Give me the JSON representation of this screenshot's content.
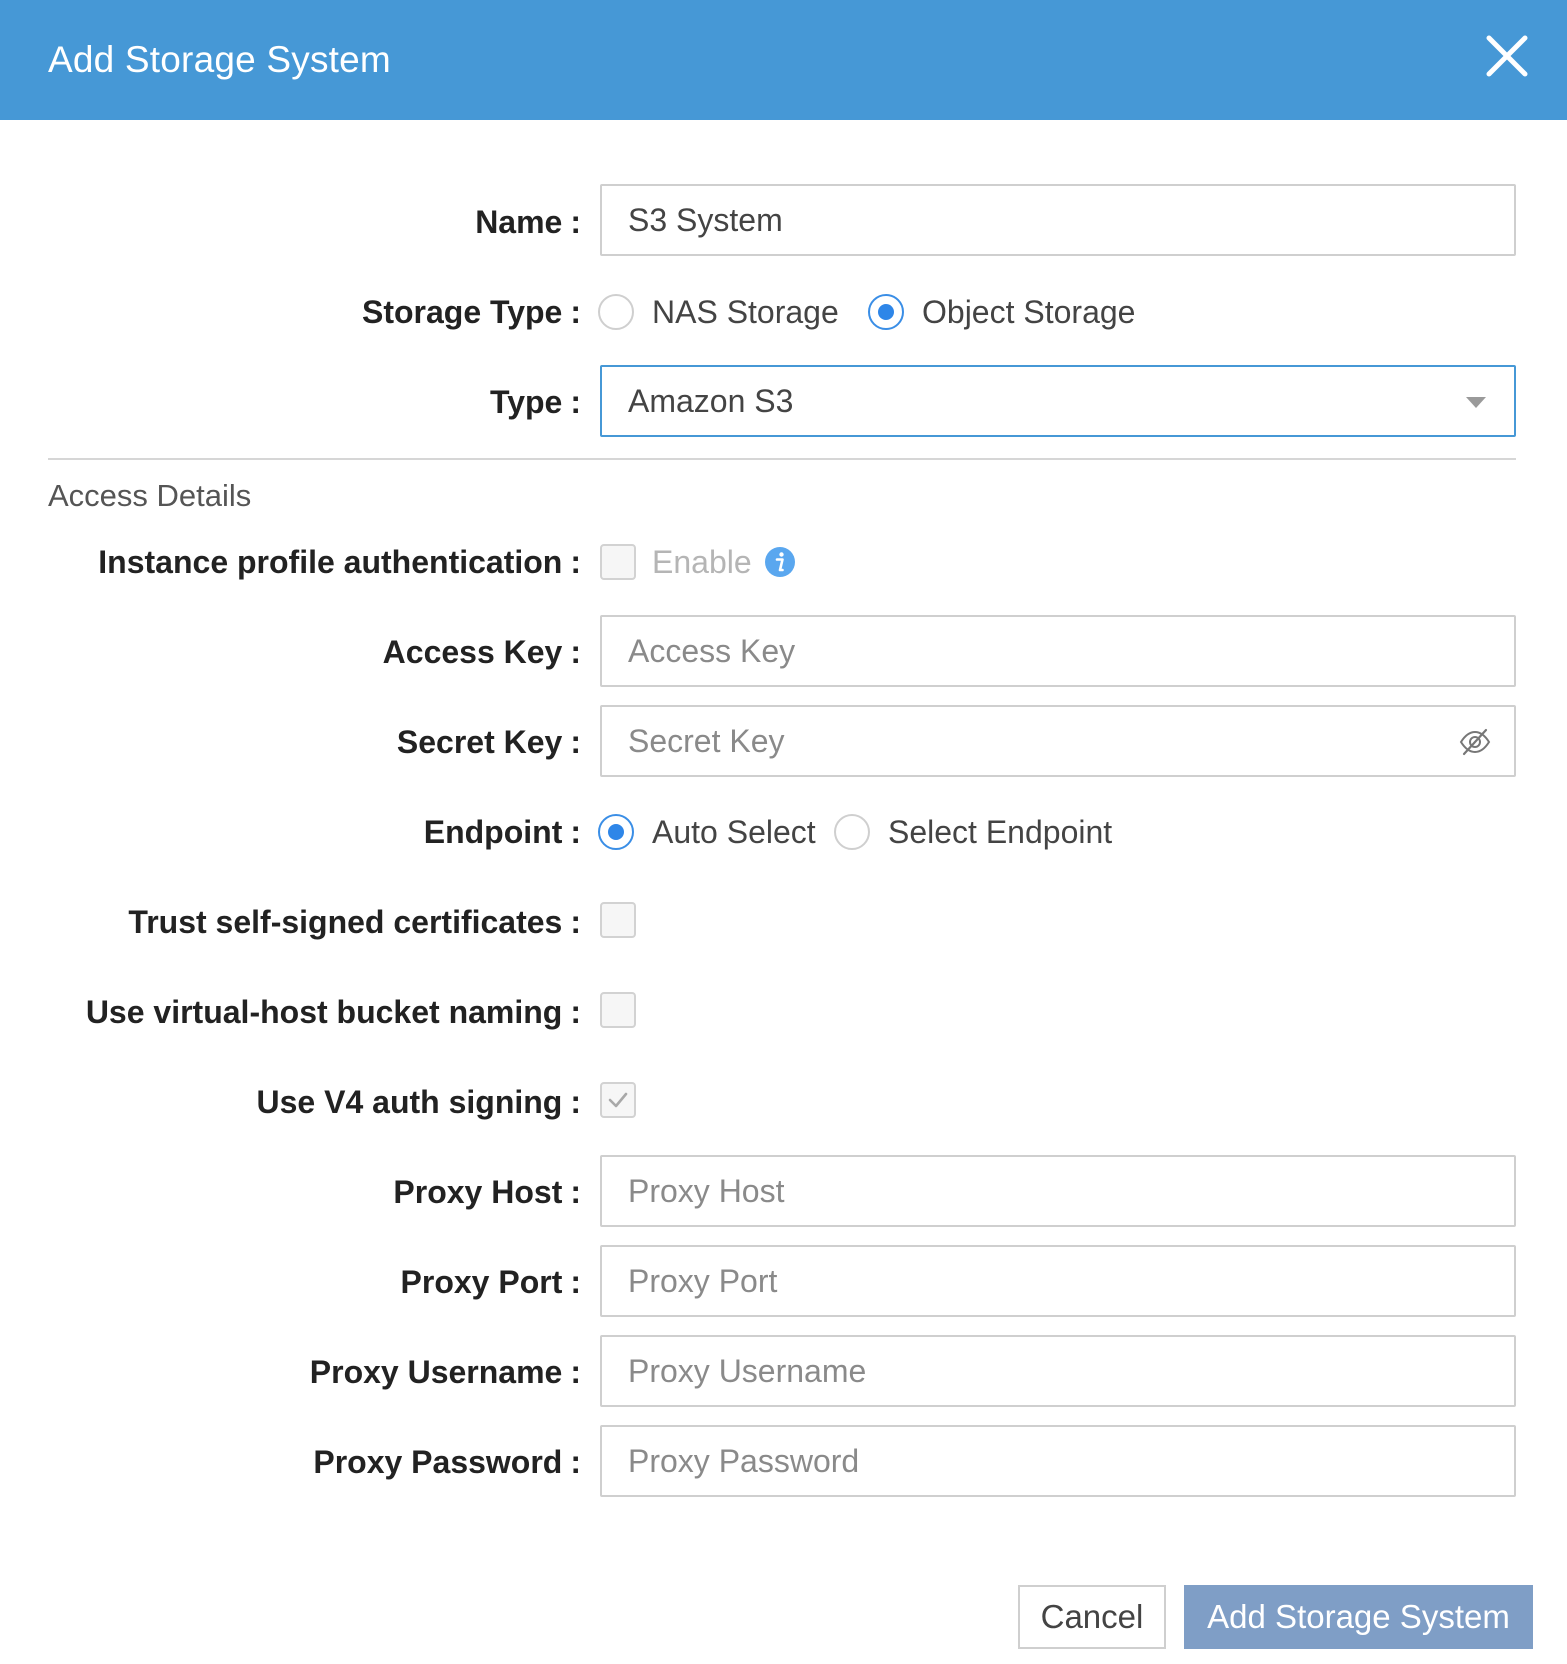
{
  "header": {
    "title": "Add Storage System"
  },
  "form": {
    "name": {
      "label": "Name",
      "value": "S3 System"
    },
    "storage_type": {
      "label": "Storage Type",
      "options": [
        "NAS Storage",
        "Object Storage"
      ],
      "selected": "Object Storage"
    },
    "type": {
      "label": "Type",
      "value": "Amazon S3"
    }
  },
  "access": {
    "section_title": "Access Details",
    "instance_profile": {
      "label": "Instance profile authentication",
      "option": "Enable",
      "checked": false
    },
    "access_key": {
      "label": "Access Key",
      "placeholder": "Access Key"
    },
    "secret_key": {
      "label": "Secret Key",
      "placeholder": "Secret Key"
    },
    "endpoint": {
      "label": "Endpoint",
      "options": [
        "Auto Select",
        "Select Endpoint"
      ],
      "selected": "Auto Select"
    },
    "trust_self_signed": {
      "label": "Trust self-signed certificates",
      "checked": false
    },
    "virtual_host": {
      "label": "Use virtual-host bucket naming",
      "checked": false
    },
    "v4_auth": {
      "label": "Use V4 auth signing",
      "checked": true
    },
    "proxy_host": {
      "label": "Proxy Host",
      "placeholder": "Proxy Host"
    },
    "proxy_port": {
      "label": "Proxy Port",
      "placeholder": "Proxy Port"
    },
    "proxy_username": {
      "label": "Proxy Username",
      "placeholder": "Proxy Username"
    },
    "proxy_password": {
      "label": "Proxy Password",
      "placeholder": "Proxy Password"
    }
  },
  "footer": {
    "cancel_label": "Cancel",
    "submit_label": "Add Storage System"
  },
  "colors": {
    "header": "#4698d6",
    "radio_checked": "#2e86e8",
    "primary_button": "#7f9ec6"
  },
  "icons": {
    "close": "close-icon",
    "info": "info-icon",
    "eye": "eye-slash-icon",
    "check": "checkmark-icon"
  }
}
